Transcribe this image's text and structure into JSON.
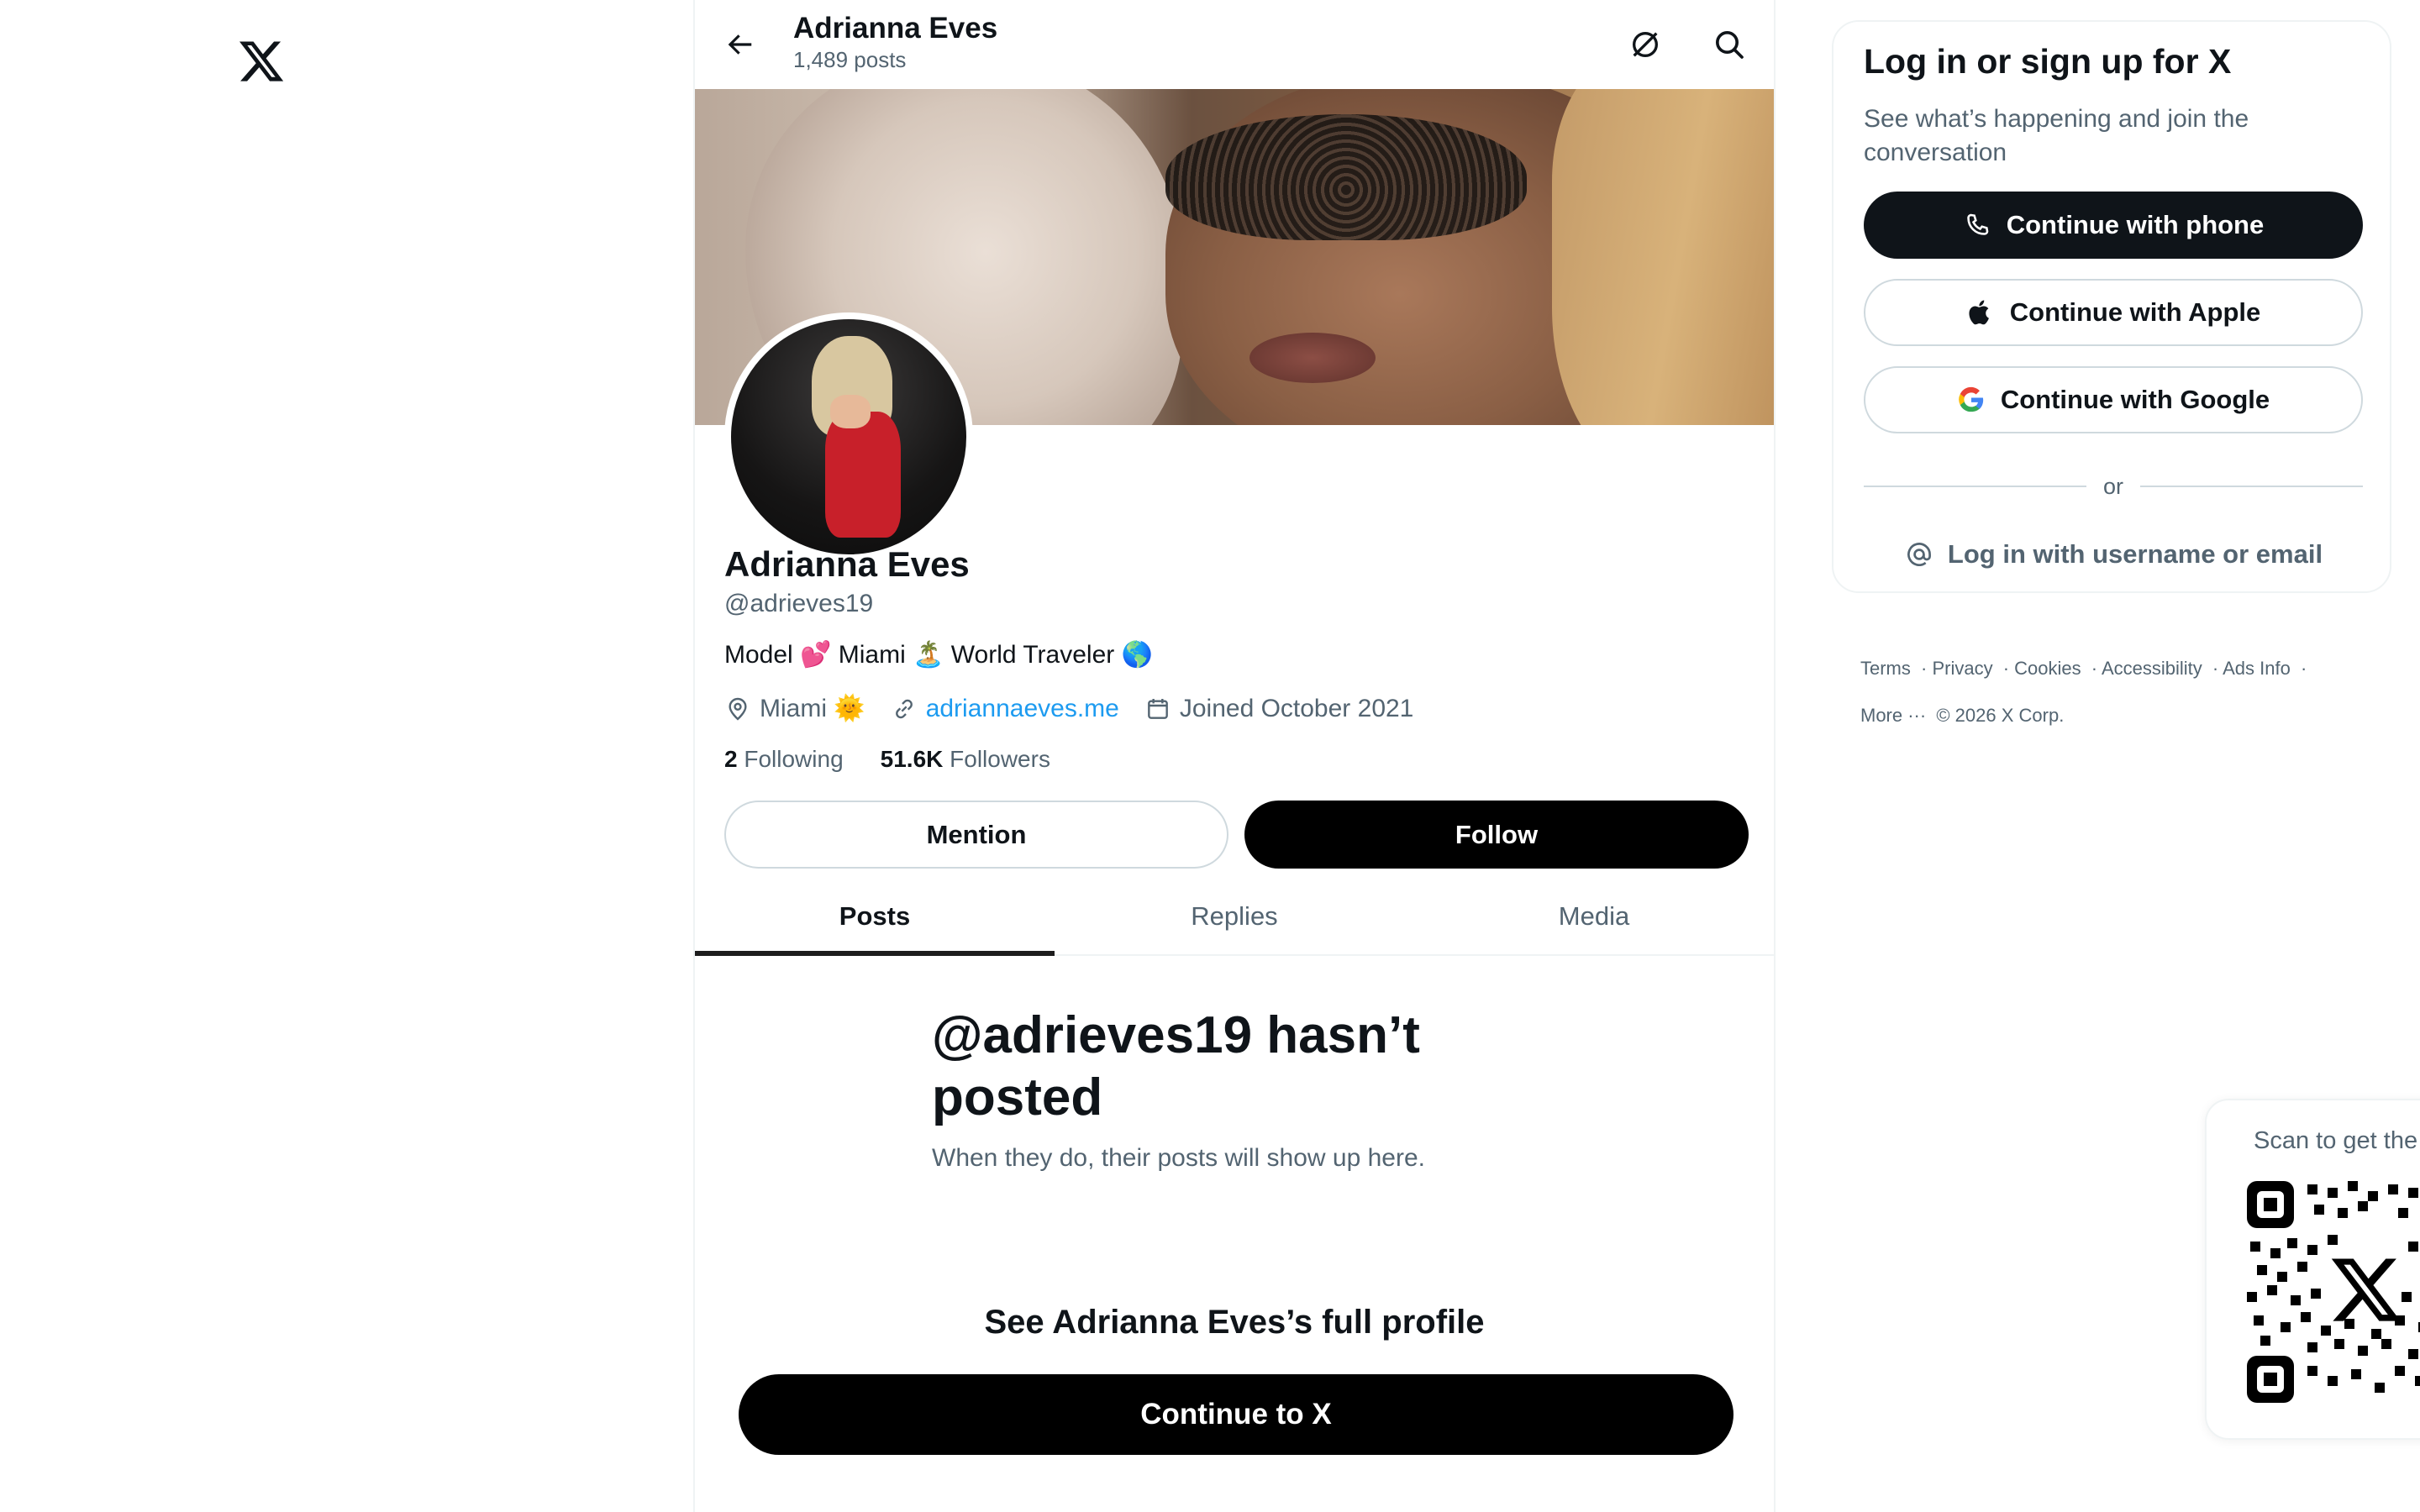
{
  "header": {
    "title": "Adrianna Eves",
    "subtitle": "1,489 posts"
  },
  "profile": {
    "name": "Adrianna Eves",
    "handle": "@adrieves19",
    "bio": "Model 💕 Miami 🏝️ World Traveler 🌎",
    "location": "Miami 🌞",
    "website": "adriannaeves.me",
    "joined": "Joined October 2021",
    "following_count": "2",
    "following_label": "Following",
    "followers_count": "51.6K",
    "followers_label": "Followers",
    "mention_label": "Mention",
    "follow_label": "Follow"
  },
  "tabs": [
    {
      "label": "Posts",
      "active": true
    },
    {
      "label": "Replies",
      "active": false
    },
    {
      "label": "Media",
      "active": false
    }
  ],
  "empty_state": {
    "title": "@adrieves19 hasn’t posted",
    "subtitle": "When they do, their posts will show up here."
  },
  "cta": {
    "heading": "See Adrianna Eves’s full profile",
    "button": "Continue to X"
  },
  "login": {
    "title": "Log in or sign up for X",
    "subtitle": "See what’s happening and join the conversation",
    "phone": "Continue with phone",
    "apple": "Continue with Apple",
    "google": "Continue with Google",
    "or": "or",
    "username": "Log in with username or email"
  },
  "footer": {
    "links": [
      "Terms",
      "Privacy",
      "Cookies",
      "Accessibility",
      "Ads Info"
    ],
    "more": "More ···",
    "copyright": "© 2026 X Corp."
  },
  "qr": {
    "label": "Scan to get the"
  },
  "icons": {
    "logo": "x-logo-icon",
    "back": "back-arrow-icon",
    "grok": "grok-icon",
    "search": "search-icon",
    "location": "location-pin-icon",
    "link": "link-icon",
    "calendar": "calendar-icon",
    "phone": "phone-icon",
    "apple": "apple-icon",
    "google": "google-icon",
    "at": "at-sign-icon"
  },
  "colors": {
    "text": "#0f1419",
    "muted": "#536471",
    "link": "#1d9bf0",
    "border": "#cfd9de"
  }
}
